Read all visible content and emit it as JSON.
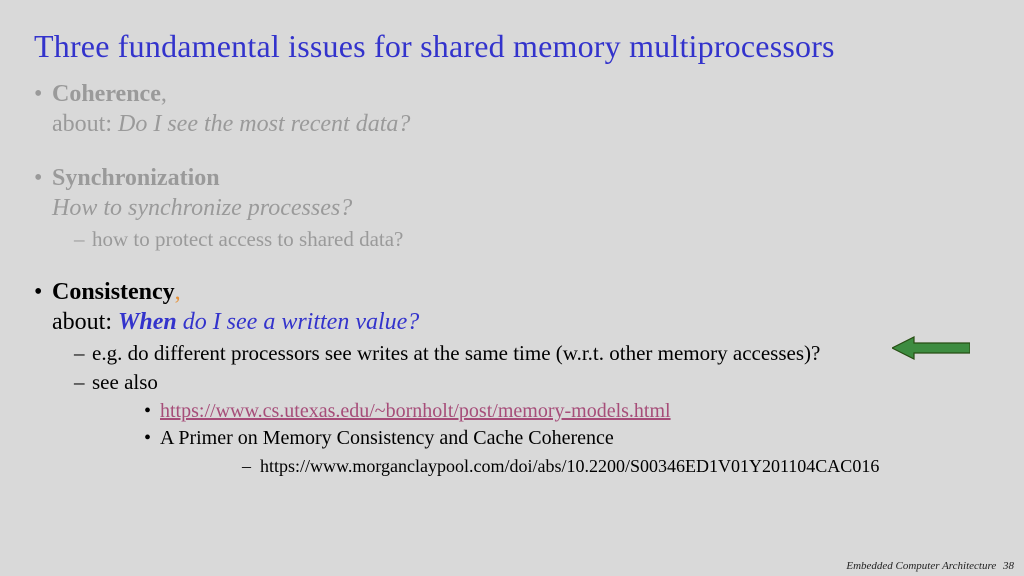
{
  "title": "Three fundamental issues for shared memory multiprocessors",
  "issues": [
    {
      "name": "Coherence",
      "comma": ",",
      "about_label": "about: ",
      "about_q": "Do I see the most recent data?",
      "sub": [],
      "dim": true
    },
    {
      "name": "Synchronization",
      "comma": "",
      "about_label": "",
      "about_q": "How to synchronize processes?",
      "sub": [
        {
          "text": "how to protect access to shared data?"
        }
      ],
      "dim": true
    },
    {
      "name": "Consistency",
      "comma": ",",
      "about_label": "about: ",
      "when": "When",
      "about_q": " do I see a written value?",
      "sub": [
        {
          "text": "e.g. do different processors see writes at the same time (w.r.t. other memory accesses)?"
        },
        {
          "text": "see also",
          "links": [
            {
              "url": "https://www.cs.utexas.edu/~bornholt/post/memory-models.html",
              "is_link": true
            },
            {
              "text": "A Primer on Memory Consistency and Cache Coherence",
              "sub": [
                {
                  "text": "https://www.morganclaypool.com/doi/abs/10.2200/S00346ED1V01Y201104CAC016"
                }
              ]
            }
          ]
        }
      ],
      "dim": false
    }
  ],
  "arrow": {
    "fill": "#3d8c40",
    "stroke": "#274e13"
  },
  "footer": {
    "course": "Embedded Computer Architecture",
    "page": "38"
  }
}
